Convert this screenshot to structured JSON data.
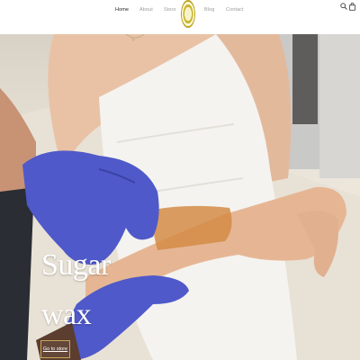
{
  "nav": {
    "items": [
      {
        "label": "Home",
        "active": true
      },
      {
        "label": "About",
        "active": false
      },
      {
        "label": "Store",
        "active": false
      },
      {
        "label": "Blog",
        "active": false
      },
      {
        "label": "Contact",
        "active": false
      }
    ]
  },
  "icons": {
    "search": "search-icon",
    "cart": "shopping-bag-icon",
    "logo": "brand-logo"
  },
  "hero": {
    "title_line1": "Sugar",
    "title_line2": "wax",
    "cta_label": "Go to store"
  },
  "colors": {
    "glove": "#4f59c9",
    "cta_border": "#c9a75a",
    "logo": "#c8b52a"
  }
}
